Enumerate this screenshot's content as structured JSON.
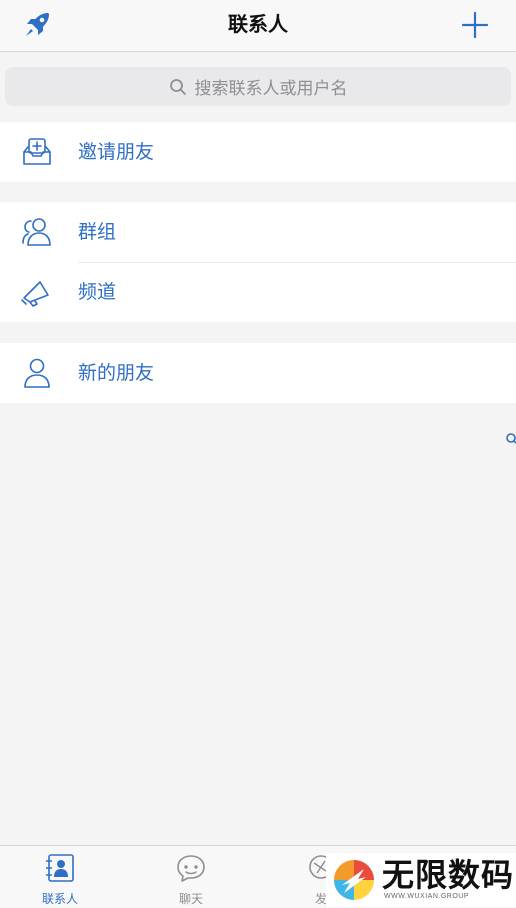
{
  "navbar": {
    "title": "联系人",
    "left_icon": "rocket-icon",
    "right_icon": "plus-icon"
  },
  "search": {
    "placeholder": "搜索联系人或用户名",
    "icon": "search-icon"
  },
  "sections": [
    {
      "items": [
        {
          "label": "邀请朋友",
          "icon": "invite-inbox-icon"
        }
      ]
    },
    {
      "items": [
        {
          "label": "群组",
          "icon": "group-icon"
        },
        {
          "label": "频道",
          "icon": "megaphone-icon"
        }
      ]
    },
    {
      "items": [
        {
          "label": "新的朋友",
          "icon": "person-icon"
        }
      ]
    }
  ],
  "tabbar": {
    "tabs": [
      {
        "label": "联系人",
        "icon": "contacts-icon",
        "active": true
      },
      {
        "label": "聊天",
        "icon": "chat-bubble-icon",
        "active": false
      },
      {
        "label": "发",
        "icon": "discover-icon",
        "active": false
      }
    ]
  },
  "watermark": {
    "title": "无限数码",
    "subtitle": "WWW.WUXIAN.GROUP"
  },
  "colors": {
    "accent": "#2f6fc4",
    "background": "#f4f4f5",
    "bar": "#f8f8f8"
  }
}
